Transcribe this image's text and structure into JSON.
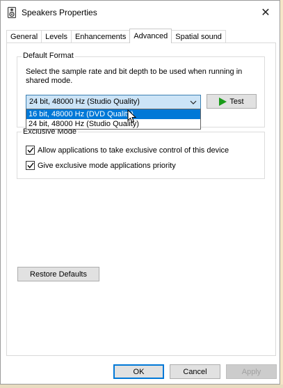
{
  "window": {
    "title": "Speakers Properties",
    "close_glyph": "✕"
  },
  "tabs": [
    {
      "label": "General"
    },
    {
      "label": "Levels"
    },
    {
      "label": "Enhancements"
    },
    {
      "label": "Advanced",
      "active": true
    },
    {
      "label": "Spatial sound"
    }
  ],
  "default_format": {
    "group_label": "Default Format",
    "description": "Select the sample rate and bit depth to be used when running in shared mode.",
    "selected_value": "24 bit, 48000 Hz (Studio Quality)",
    "options": [
      {
        "label": "16 bit, 48000 Hz (DVD Quality)",
        "highlighted": true
      },
      {
        "label": "24 bit, 48000 Hz (Studio Quality)",
        "highlighted": false
      }
    ],
    "test_label": "Test"
  },
  "exclusive_mode": {
    "group_label": "Exclusive Mode",
    "allow_exclusive": {
      "label": "Allow applications to take exclusive control of this device",
      "checked": true
    },
    "give_priority": {
      "label": "Give exclusive mode applications priority",
      "checked": true
    }
  },
  "buttons": {
    "restore_defaults": "Restore Defaults",
    "ok": "OK",
    "cancel": "Cancel",
    "apply": "Apply"
  },
  "colors": {
    "selection": "#0078d7",
    "combo_bg": "#cce4f7",
    "play_green": "#1a9c1a"
  }
}
